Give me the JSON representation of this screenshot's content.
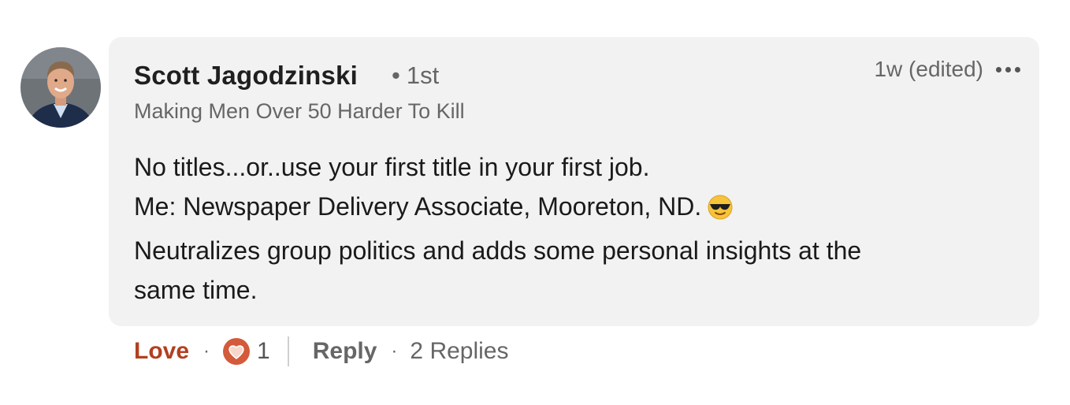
{
  "comment": {
    "author_name": "Scott Jagodzinski",
    "connection_degree": "1st",
    "degree_separator": "•",
    "headline": "Making Men Over 50 Harder To Kill",
    "timestamp": "1w (edited)",
    "more_icon": "ellipsis-icon",
    "emoji_icon": "sunglasses-emoji",
    "body_lines": [
      "No titles...or..use your first title in your first job.",
      "Me: Newspaper Delivery Associate, Mooreton, ND.",
      "Neutralizes group politics and adds some personal insights at the",
      "same time."
    ]
  },
  "actions": {
    "reaction_label": "Love",
    "separator": "·",
    "reaction_icon": "heart-reaction-icon",
    "reaction_count": "1",
    "reply_label": "Reply",
    "replies_label": "2 Replies"
  },
  "colors": {
    "bubble_bg": "#f2f2f2",
    "love_accent": "#b24020",
    "heart_fill": "#d35a3a",
    "secondary_text": "#666666"
  }
}
